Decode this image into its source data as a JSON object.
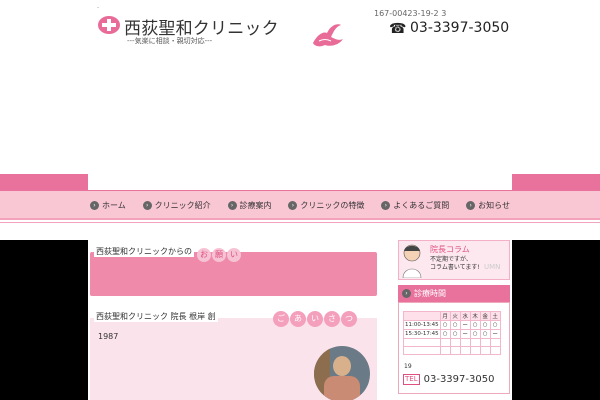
{
  "header": {
    "tiny_mark": "-",
    "title": "西荻聖和クリニック",
    "subtitle": "---気楽に相談・親切対応---",
    "address": "167-00423-19-2 3",
    "phone": "03-3397-3050"
  },
  "nav": {
    "items": [
      {
        "label": "ホーム"
      },
      {
        "label": "クリニック紹介"
      },
      {
        "label": "診療案内"
      },
      {
        "label": "クリニックの特徴"
      },
      {
        "label": "よくあるご質問"
      },
      {
        "label": "お知らせ"
      }
    ]
  },
  "main": {
    "request_label": "西荻聖和クリニックからの",
    "request_circles": [
      "お",
      "願",
      "い"
    ],
    "greeting_label": "西荻聖和クリニック 院長 根岸 創",
    "greeting_circles": [
      "ご",
      "あ",
      "い",
      "さ",
      "つ"
    ],
    "year": "1987"
  },
  "sidebar": {
    "column_title": "院長コラム",
    "column_line1": "不定期ですが、",
    "column_line2": "コラム書いてます!",
    "column_watermark": "UMN",
    "hours_title": "診療時間",
    "hours_days": [
      "月",
      "火",
      "水",
      "木",
      "金",
      "土"
    ],
    "hours_rows": [
      {
        "label": "11:00-13:45",
        "cells": [
          "○",
          "○",
          "ー",
          "○",
          "○",
          "○"
        ]
      },
      {
        "label": "15:30-17:45",
        "cells": [
          "○",
          "○",
          "ー",
          "○",
          "○",
          "ー"
        ]
      },
      {
        "label": "",
        "cells": [
          "",
          "",
          "",
          "",
          "",
          ""
        ]
      },
      {
        "label": "",
        "cells": [
          "",
          "",
          "",
          "",
          "",
          ""
        ]
      }
    ],
    "number_19": "19",
    "tel_badge": "TEL",
    "tel": "03-3397-3050"
  },
  "colors": {
    "pink": "#e8729c",
    "light_pink": "#f9c6d4",
    "pale_pink": "#fbe3eb"
  },
  "icons": {
    "logo": "pink-cross-logo-icon",
    "bird": "bird-icon",
    "phone": "telephone-icon",
    "nav_arrow": "circle-arrow-icon"
  }
}
